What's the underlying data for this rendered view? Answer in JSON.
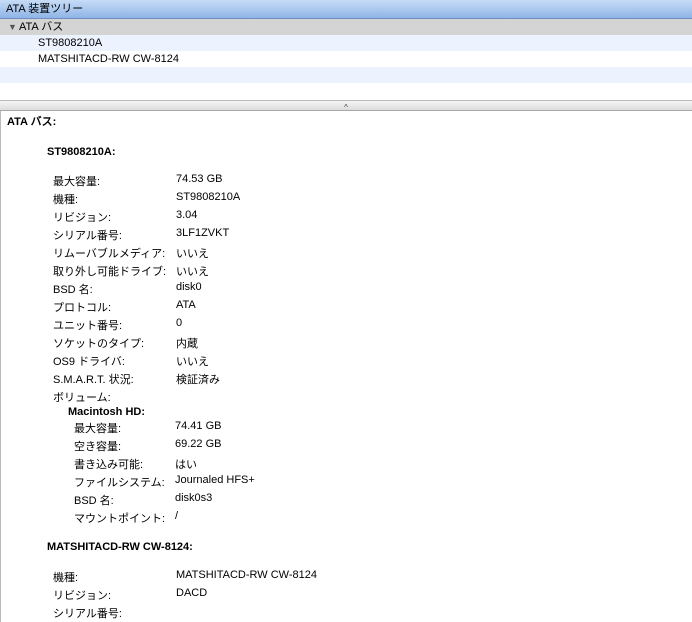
{
  "tree": {
    "header": "ATA 装置ツリー",
    "root": {
      "label": "ATA バス",
      "expanded": true
    },
    "children": [
      "ST9808210A",
      "MATSHITACD-RW  CW-8124"
    ]
  },
  "splitter": {
    "glyph": "^"
  },
  "detail": {
    "bus_title": "ATA バス:",
    "device1": {
      "title": "ST9808210A:",
      "rows": [
        {
          "label": "最大容量:",
          "value": "74.53 GB"
        },
        {
          "label": "機種:",
          "value": "ST9808210A"
        },
        {
          "label": "リビジョン:",
          "value": "3.04"
        },
        {
          "label": "シリアル番号:",
          "value": "3LF1ZVKT"
        },
        {
          "label": "リムーバブルメディア:",
          "value": "いいえ"
        },
        {
          "label": "取り外し可能ドライブ:",
          "value": "いいえ"
        },
        {
          "label": "BSD 名:",
          "value": "disk0"
        },
        {
          "label": "プロトコル:",
          "value": "ATA"
        },
        {
          "label": "ユニット番号:",
          "value": "0"
        },
        {
          "label": "ソケットのタイプ:",
          "value": "内蔵"
        },
        {
          "label": "OS9 ドライバ:",
          "value": "いいえ"
        },
        {
          "label": "S.M.A.R.T. 状況:",
          "value": "検証済み"
        },
        {
          "label": "ボリューム:",
          "value": ""
        }
      ],
      "volume": {
        "title": "Macintosh HD:",
        "rows": [
          {
            "label": "最大容量:",
            "value": "74.41 GB"
          },
          {
            "label": "空き容量:",
            "value": "69.22 GB"
          },
          {
            "label": "書き込み可能:",
            "value": "はい"
          },
          {
            "label": "ファイルシステム:",
            "value": "Journaled HFS+"
          },
          {
            "label": "BSD 名:",
            "value": "disk0s3"
          },
          {
            "label": "マウントポイント:",
            "value": "/"
          }
        ]
      }
    },
    "device2": {
      "title": "MATSHITACD-RW  CW-8124:",
      "rows": [
        {
          "label": "機種:",
          "value": "MATSHITACD-RW  CW-8124"
        },
        {
          "label": "リビジョン:",
          "value": "DACD"
        },
        {
          "label": "シリアル番号:",
          "value": ""
        }
      ]
    }
  }
}
